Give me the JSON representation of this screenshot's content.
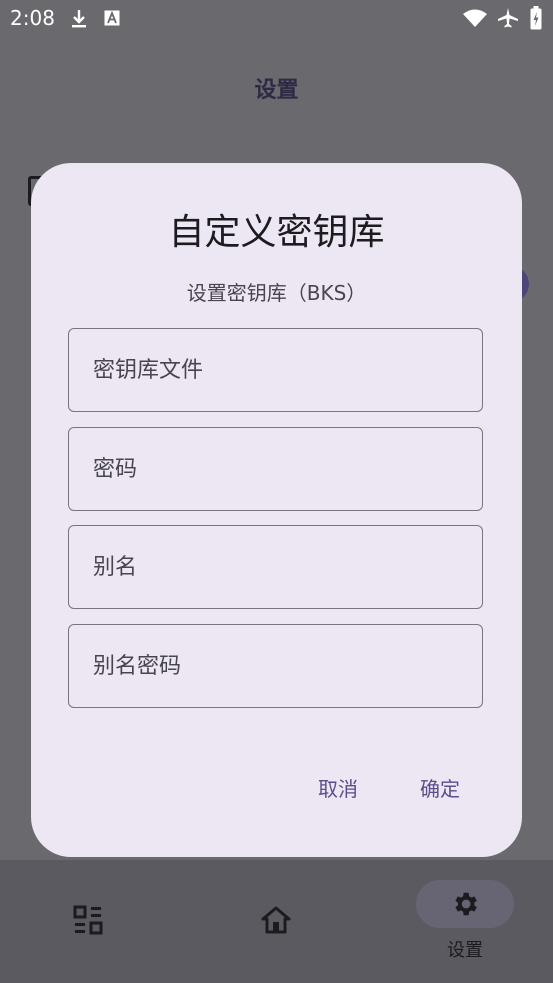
{
  "status_bar": {
    "time": "2:08",
    "icons": [
      "download-icon",
      "a-icon",
      "wifi-icon",
      "airplane-icon",
      "battery-icon"
    ]
  },
  "app_bar": {
    "title": "设置"
  },
  "dialog": {
    "title": "自定义密钥库",
    "subtitle": "设置密钥库（BKS）",
    "fields": [
      {
        "placeholder": "密钥库文件",
        "value": ""
      },
      {
        "placeholder": "密码",
        "value": ""
      },
      {
        "placeholder": "别名",
        "value": ""
      },
      {
        "placeholder": "别名密码",
        "value": ""
      }
    ],
    "cancel_label": "取消",
    "confirm_label": "确定"
  },
  "bottom_nav": {
    "items": [
      {
        "icon": "grid-icon",
        "label": ""
      },
      {
        "icon": "home-icon",
        "label": ""
      },
      {
        "icon": "gear-icon",
        "label": "设置",
        "selected": true
      }
    ]
  },
  "colors": {
    "dialog_bg": "#ede6f3",
    "accent": "#5a4e8c",
    "scrim": "#6a696e"
  }
}
